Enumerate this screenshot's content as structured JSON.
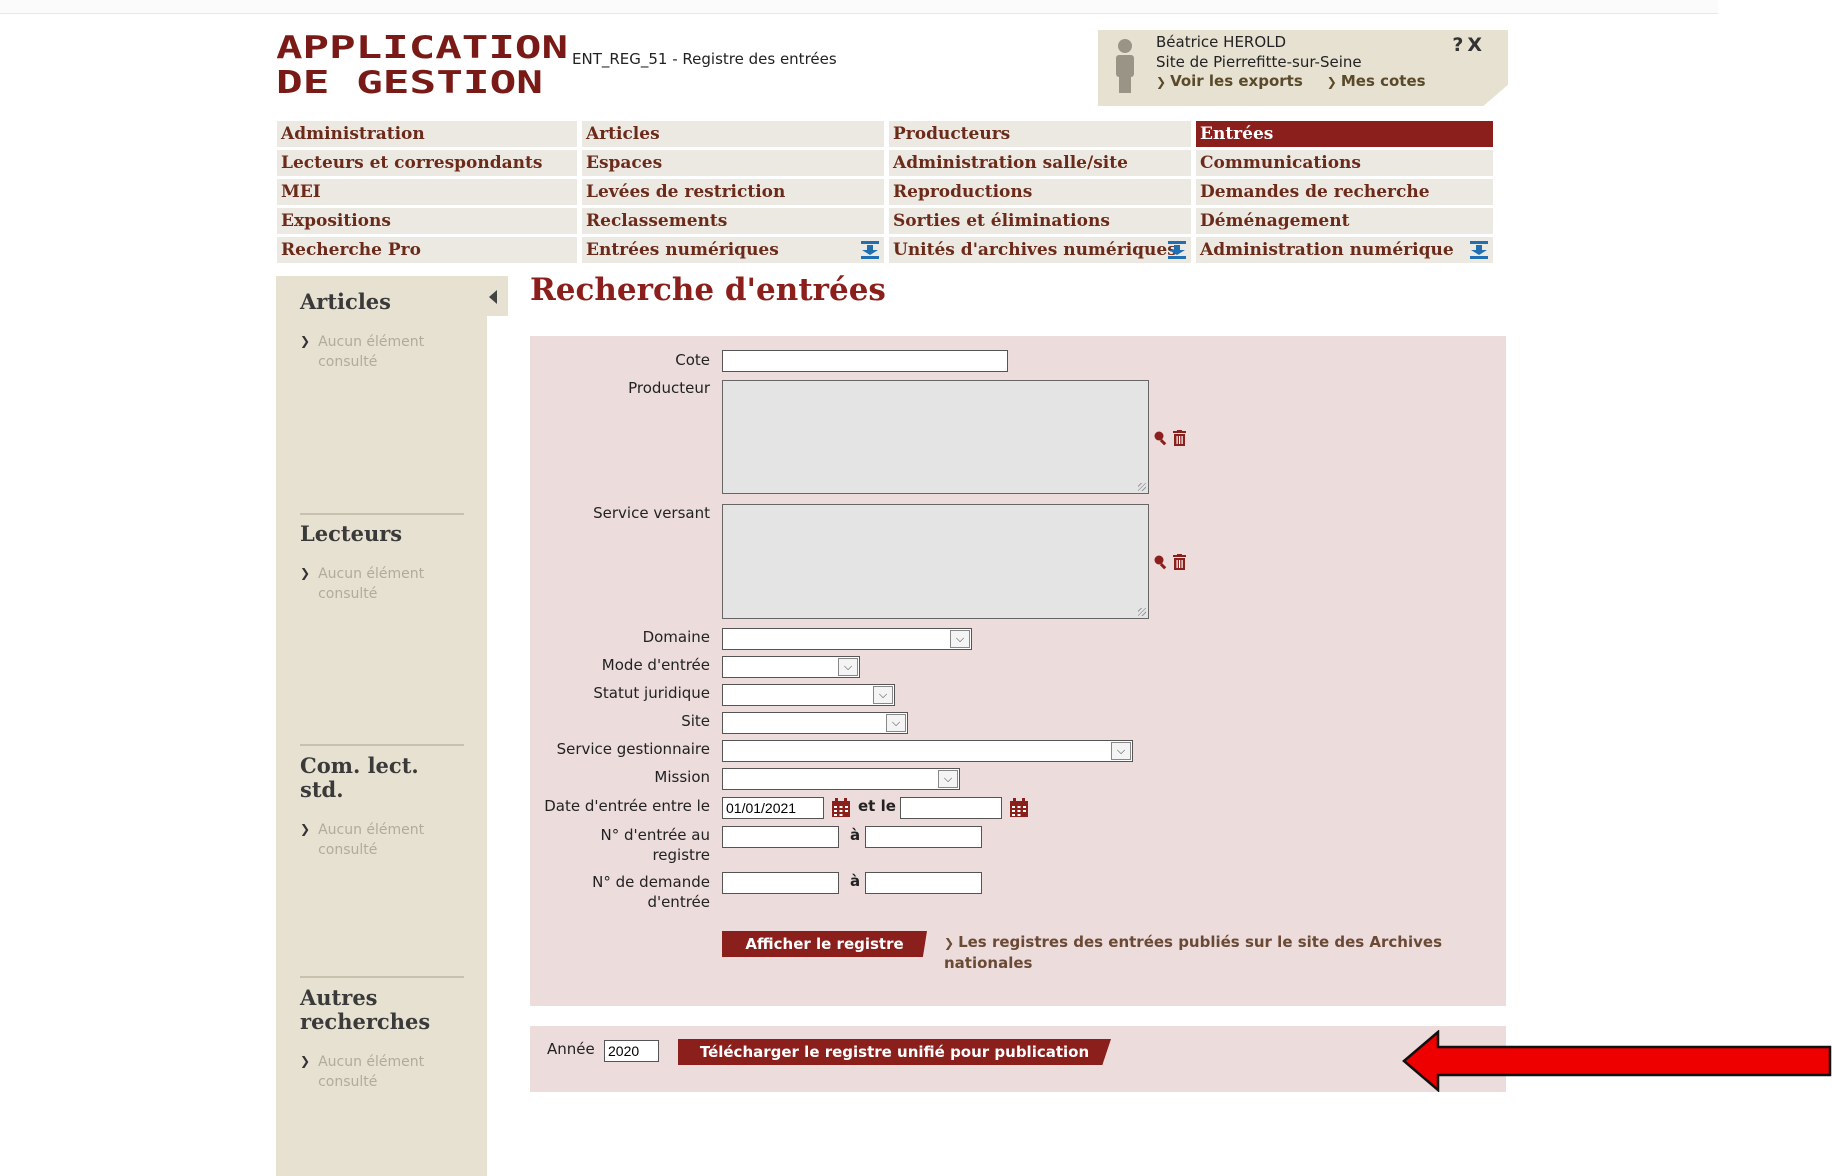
{
  "header": {
    "logo_line1": "APPLICATION",
    "logo_line2": "DE GESTION",
    "screen_code": "ENT_REG_51 - Registre des entrées"
  },
  "user": {
    "name": "Béatrice HEROLD",
    "site": "Site de Pierrefitte-sur-Seine",
    "exports_link": "Voir les exports",
    "cotes_link": "Mes cotes",
    "help": "?",
    "close": "X"
  },
  "menu": {
    "items": [
      {
        "label": "Administration"
      },
      {
        "label": "Articles"
      },
      {
        "label": "Producteurs"
      },
      {
        "label": "Entrées",
        "active": true
      },
      {
        "label": "Lecteurs et correspondants"
      },
      {
        "label": "Espaces"
      },
      {
        "label": "Administration salle/site"
      },
      {
        "label": "Communications"
      },
      {
        "label": "MEI"
      },
      {
        "label": "Levées de restriction"
      },
      {
        "label": "Reproductions"
      },
      {
        "label": "Demandes de recherche"
      },
      {
        "label": "Expositions"
      },
      {
        "label": "Reclassements"
      },
      {
        "label": "Sorties et éliminations"
      },
      {
        "label": "Déménagement"
      },
      {
        "label": "Recherche Pro"
      },
      {
        "label": "Entrées numériques",
        "icon": "digital-icon"
      },
      {
        "label": "Unités d'archives numériques",
        "icon": "digital-icon"
      },
      {
        "label": "Administration numérique",
        "icon": "digital-icon"
      }
    ]
  },
  "sidebar": {
    "sections": [
      {
        "title": "Articles",
        "item": "Aucun élément consulté"
      },
      {
        "title": "Lecteurs",
        "item": "Aucun élément consulté"
      },
      {
        "title": "Com. lect. std.",
        "item": "Aucun élément consulté"
      },
      {
        "title": "Autres recherches",
        "item": "Aucun élément consulté"
      }
    ]
  },
  "page": {
    "title": "Recherche d'entrées"
  },
  "form": {
    "cote_label": "Cote",
    "cote_value": "",
    "producteur_label": "Producteur",
    "service_versant_label": "Service versant",
    "domaine_label": "Domaine",
    "mode_label": "Mode d'entrée",
    "statut_label": "Statut juridique",
    "site_label": "Site",
    "service_gest_label": "Service gestionnaire",
    "mission_label": "Mission",
    "date_label": "Date d'entrée entre le",
    "date_from": "01/01/2021",
    "date_and": "et le",
    "date_to": "",
    "num_registre_label_1": "N° d'entrée au",
    "num_registre_label_2": "registre",
    "num_demande_label_1": "N° de demande",
    "num_demande_label_2": "d'entrée",
    "a_label": "à",
    "submit": "Afficher le registre",
    "pub_link": "Les registres des entrées publiés sur le site des Archives nationales"
  },
  "year_form": {
    "label": "Année",
    "value": "2020",
    "button": "Télécharger le registre unifié pour publication"
  },
  "colors": {
    "accent": "#8b1f1c",
    "panel": "#ecdcdc",
    "sidebar": "#e7e1d2",
    "annotation_arrow": "#ee0000"
  }
}
